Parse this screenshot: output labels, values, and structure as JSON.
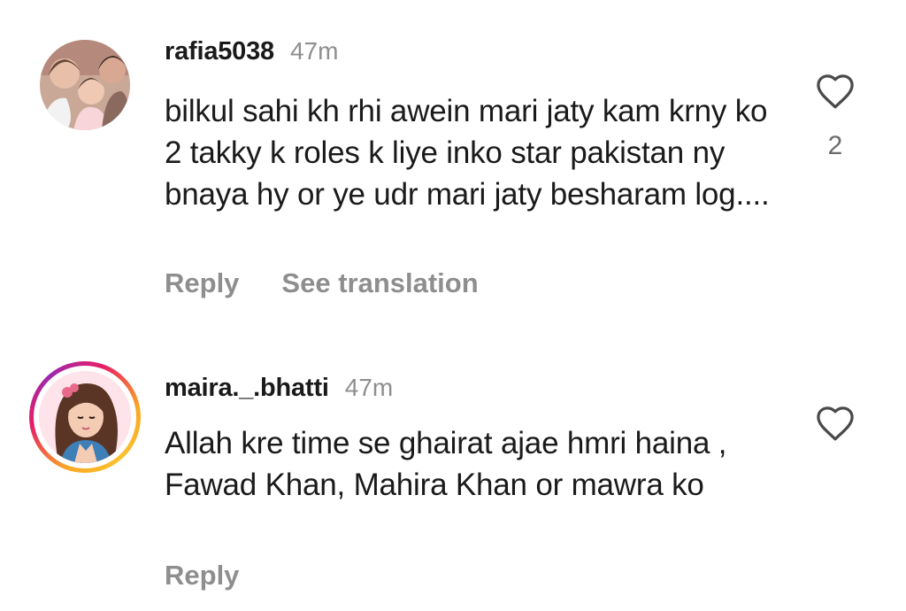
{
  "comments": [
    {
      "username": "rafia5038",
      "time": "47m",
      "text": "bilkul sahi kh rhi awein mari jaty kam krny ko 2 takky k roles k liye inko star pakistan ny bnaya hy or ye udr mari jaty besharam log....",
      "reply_label": "Reply",
      "translate_label": "See translation",
      "like_icon": "heart-outline-icon",
      "like_count": "2"
    },
    {
      "username": "maira._.bhatti",
      "time": "47m",
      "text": "Allah kre time se ghairat ajae hmri haina , Fawad Khan, Mahira Khan or mawra ko",
      "reply_label": "Reply",
      "like_icon": "heart-outline-icon",
      "avatar_story_ring": true
    }
  ],
  "colors": {
    "text_primary": "#1a1a1a",
    "text_secondary": "#8e8e8e",
    "background": "#ffffff",
    "story_ring_start": "#f9a825",
    "story_ring_end": "#e91e63"
  }
}
